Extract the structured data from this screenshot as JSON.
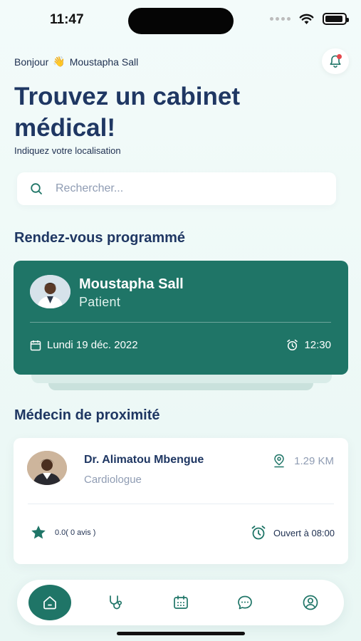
{
  "status_bar": {
    "time": "11:47"
  },
  "header": {
    "greeting": "Bonjour",
    "wave_emoji": "👋",
    "user_name": "Moustapha Sall",
    "title": "Trouvez un cabinet médical!",
    "subtitle": "Indiquez votre localisation"
  },
  "search": {
    "placeholder": "Rechercher...",
    "value": ""
  },
  "appointments": {
    "section_title": "Rendez-vous programmé",
    "card": {
      "name": "Moustapha Sall",
      "role": "Patient",
      "date": "Lundi 19 déc. 2022",
      "time": "12:30"
    }
  },
  "nearby": {
    "section_title": "Médecin de proximité",
    "doctor": {
      "name": "Dr. Alimatou Mbengue",
      "specialty": "Cardiologue",
      "distance": "1.29 KM",
      "rating": "0.0( 0 avis )",
      "hours": "Ouvert à 08:00"
    }
  },
  "tabbar": {
    "tabs": [
      {
        "icon": "home-icon",
        "active": true
      },
      {
        "icon": "stethoscope-icon",
        "active": false
      },
      {
        "icon": "calendar-icon",
        "active": false
      },
      {
        "icon": "chat-icon",
        "active": false
      },
      {
        "icon": "profile-icon",
        "active": false
      }
    ]
  },
  "colors": {
    "primary": "#1f7567",
    "title": "#1f3763",
    "muted": "#8f9cb3",
    "background": "#f3fbfa",
    "notification_dot": "#e5484d"
  }
}
